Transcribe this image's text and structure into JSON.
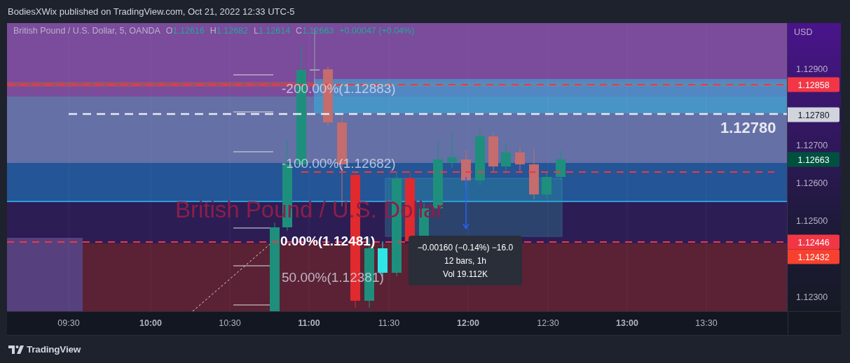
{
  "header": {
    "attribution": "BodiesXWix published on TradingView.com, Oct 21, 2022 12:33 UTC-5"
  },
  "legend": {
    "symbol": "British Pound / U.S. Dollar, 5, OANDA",
    "values": [
      {
        "label": "O",
        "value": "1.12616"
      },
      {
        "label": "H",
        "value": "1.12682"
      },
      {
        "label": "L",
        "value": "1.12614"
      },
      {
        "label": "C",
        "value": "1.12663"
      }
    ],
    "change": "+0.00047 (+0.04%)"
  },
  "chart": {
    "symbol_watermark": "British Pound / U.S. Dollar",
    "fib_labels": [
      {
        "text": "-200.00%(1.12883)",
        "kind": "level"
      },
      {
        "text": "-100.00%(1.12682)",
        "kind": "level"
      },
      {
        "text": "0.00%(1.12481)",
        "kind": "base"
      },
      {
        "text": "50.00%(1.12381)",
        "kind": "level"
      }
    ],
    "line_label": "1.12780",
    "measure_tooltip": [
      "−0.00160 (−0.14%) −16.0",
      "12 bars, 1h",
      "Vol 19.112K"
    ]
  },
  "price_axis": {
    "currency": "USD",
    "ticks": [
      "1.12900",
      "1.12700",
      "1.12600",
      "1.12500",
      "1.12300"
    ],
    "badges": [
      {
        "text": "1.12858",
        "color": "#f23645"
      },
      {
        "text": "1.12780",
        "color": "#d1d4dc"
      },
      {
        "text": "1.12663",
        "color": "#00503f"
      },
      {
        "text": "1.12446",
        "color": "#f23645"
      },
      {
        "text": "1.12432",
        "color": "#f7412e"
      }
    ]
  },
  "time_axis": {
    "labels": [
      {
        "text": "09:30",
        "major": false
      },
      {
        "text": "10:00",
        "major": true
      },
      {
        "text": "10:30",
        "major": false
      },
      {
        "text": "11:00",
        "major": true
      },
      {
        "text": "11:30",
        "major": false
      },
      {
        "text": "12:00",
        "major": true
      },
      {
        "text": "12:30",
        "major": false
      },
      {
        "text": "13:00",
        "major": true
      },
      {
        "text": "13:30",
        "major": false
      }
    ]
  },
  "footer": {
    "brand": "TradingView"
  }
}
